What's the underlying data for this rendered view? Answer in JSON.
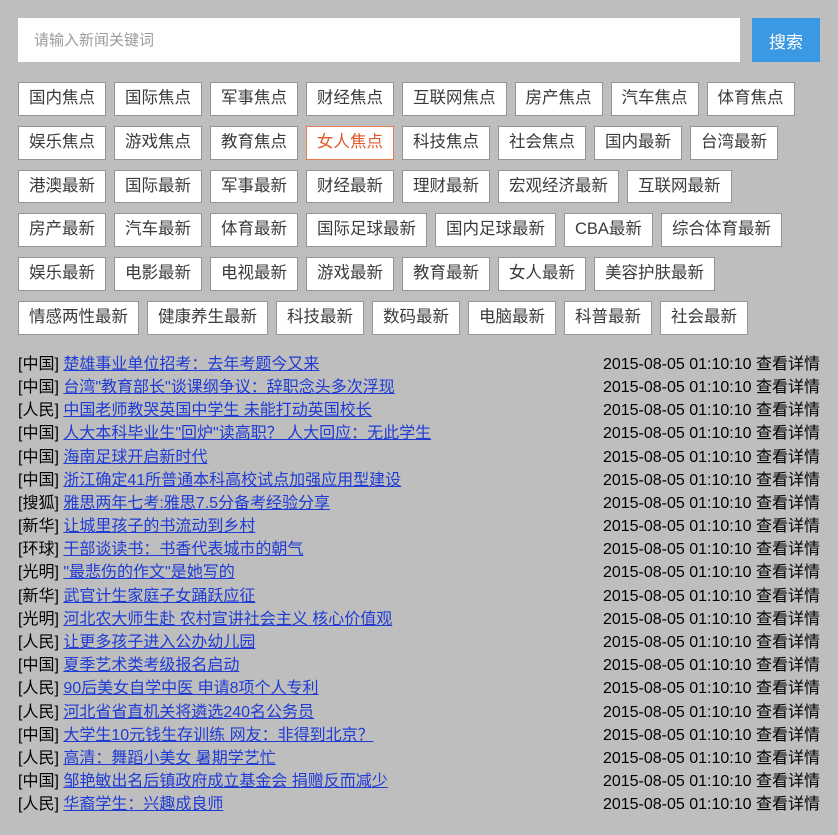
{
  "search": {
    "placeholder": "请输入新闻关键词",
    "button": "搜索"
  },
  "activeTagIndex": 11,
  "tags": [
    "国内焦点",
    "国际焦点",
    "军事焦点",
    "财经焦点",
    "互联网焦点",
    "房产焦点",
    "汽车焦点",
    "体育焦点",
    "娱乐焦点",
    "游戏焦点",
    "教育焦点",
    "女人焦点",
    "科技焦点",
    "社会焦点",
    "国内最新",
    "台湾最新",
    "港澳最新",
    "国际最新",
    "军事最新",
    "财经最新",
    "理财最新",
    "宏观经济最新",
    "互联网最新",
    "房产最新",
    "汽车最新",
    "体育最新",
    "国际足球最新",
    "国内足球最新",
    "CBA最新",
    "综合体育最新",
    "娱乐最新",
    "电影最新",
    "电视最新",
    "游戏最新",
    "教育最新",
    "女人最新",
    "美容护肤最新",
    "情感两性最新",
    "健康养生最新",
    "科技最新",
    "数码最新",
    "电脑最新",
    "科普最新",
    "社会最新"
  ],
  "detailLabel": "查看详情",
  "news": [
    {
      "source": "中国",
      "title": "楚雄事业单位招考：去年考题今又来",
      "time": "2015-08-05 01:10:10"
    },
    {
      "source": "中国",
      "title": "台湾\"教育部长\"谈课纲争议：辞职念头多次浮现",
      "time": "2015-08-05 01:10:10"
    },
    {
      "source": "人民",
      "title": "中国老师教哭英国中学生 未能打动英国校长",
      "time": "2015-08-05 01:10:10"
    },
    {
      "source": "中国",
      "title": "人大本科毕业生\"回炉\"读高职？ 人大回应：无此学生",
      "time": "2015-08-05 01:10:10"
    },
    {
      "source": "中国",
      "title": "海南足球开启新时代",
      "time": "2015-08-05 01:10:10"
    },
    {
      "source": "中国",
      "title": "浙江确定41所普通本科高校试点加强应用型建设",
      "time": "2015-08-05 01:10:10"
    },
    {
      "source": "搜狐",
      "title": "雅思两年七考:雅思7.5分备考经验分享",
      "time": "2015-08-05 01:10:10"
    },
    {
      "source": "新华",
      "title": "让城里孩子的书流动到乡村",
      "time": "2015-08-05 01:10:10"
    },
    {
      "source": "环球",
      "title": "干部谈读书：书香代表城市的朝气",
      "time": "2015-08-05 01:10:10"
    },
    {
      "source": "光明",
      "title": "\"最悲伤的作文\"是她写的",
      "time": "2015-08-05 01:10:10"
    },
    {
      "source": "新华",
      "title": "武官计生家庭子女踊跃应征",
      "time": "2015-08-05 01:10:10"
    },
    {
      "source": "光明",
      "title": "河北农大师生赴 农村宣讲社会主义 核心价值观",
      "time": "2015-08-05 01:10:10"
    },
    {
      "source": "人民",
      "title": "让更多孩子进入公办幼儿园",
      "time": "2015-08-05 01:10:10"
    },
    {
      "source": "中国",
      "title": "夏季艺术类考级报名启动",
      "time": "2015-08-05 01:10:10"
    },
    {
      "source": "人民",
      "title": "90后美女自学中医 申请8项个人专利",
      "time": "2015-08-05 01:10:10"
    },
    {
      "source": "人民",
      "title": "河北省省直机关将遴选240名公务员",
      "time": "2015-08-05 01:10:10"
    },
    {
      "source": "中国",
      "title": "大学生10元钱生存训练 网友：非得到北京？ ",
      "time": "2015-08-05 01:10:10"
    },
    {
      "source": "人民",
      "title": "高清：舞蹈小美女 暑期学艺忙",
      "time": "2015-08-05 01:10:10"
    },
    {
      "source": "中国",
      "title": "邹艳敏出名后镇政府成立基金会 捐赠反而减少",
      "time": "2015-08-05 01:10:10"
    },
    {
      "source": "人民",
      "title": "华裔学生：兴趣成良师",
      "time": "2015-08-05 01:10:10"
    }
  ]
}
